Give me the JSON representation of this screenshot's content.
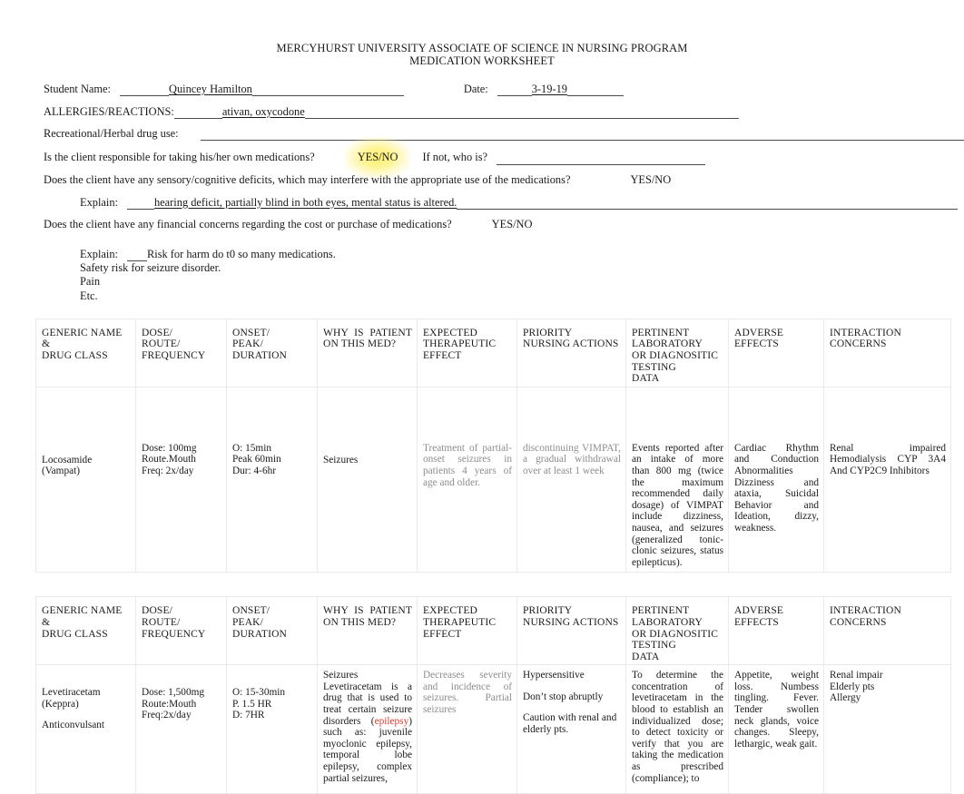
{
  "document": {
    "title_line1": "MERCYHURST UNIVERSITY ASSOCIATE OF SCIENCE IN NURSING PROGRAM",
    "title_line2": "MEDICATION WORKSHEET"
  },
  "form": {
    "student_name_label": "Student Name:",
    "student_name_value": "Quincey Hamilton",
    "date_label": "Date:",
    "date_value": "3-19-19",
    "allergies_label": "ALLERGIES/REACTIONS:",
    "allergies_value": "ativan, oxycodone",
    "recreational_label": "Recreational/Herbal drug use:",
    "recreational_value": "",
    "q1_text": "Is the client responsible for taking his/her own medications?",
    "q1_answer": "YES/NO",
    "q1_followup": "If not, who is?",
    "q1_followup_value": "",
    "q2_text": "Does the client have any sensory/cognitive deficits, which may interfere with the appropriate use of the medications?",
    "q2_answer": "YES/NO",
    "q2_explain_label": "Explain:",
    "q2_explain_value": "hearing deficit, partially blind in both eyes, mental status is altered.",
    "q3_text": "Does the client have any financial concerns regarding the cost or purchase of medications?",
    "q3_answer": "YES/NO",
    "q3_explain_label": "Explain:",
    "q3_explain_lines": [
      "Risk for harm do t0 so many medications.",
      "Safety risk for seizure disorder.",
      "Pain",
      "Etc."
    ]
  },
  "table_headers": {
    "col1": "GENERIC NAME\n&\nDRUG CLASS",
    "col2": "DOSE/\nROUTE/\nFREQUENCY",
    "col3": "ONSET/\nPEAK/\nDURATION",
    "col4": "WHY IS PATIENT ON THIS MED?",
    "col5": "EXPECTED\nTHERAPEUTIC\nEFFECT",
    "col6": "PRIORITY NURSING ACTIONS",
    "col7": "PERTINENT\nLABORATORY\nOR DIAGNOSITIC\nTESTING\nDATA",
    "col8": "ADVERSE\nEFFECTS",
    "col9": "INTERACTION\nCONCERNS"
  },
  "medications": [
    {
      "generic_name": "Locosamide\n(Vampat)",
      "drug_class": "",
      "dose": "Dose: 100mg",
      "route": "Route.Mouth",
      "frequency": "Freq: 2x/day",
      "onset": "O: 15min",
      "peak": "Peak 60min",
      "duration": "Dur: 4-6hr",
      "why_on_med": "Seizures",
      "why_on_med_detail": "",
      "why_link_word": "",
      "why_on_med_tail": "",
      "expected_effect": "Treatment of partial-onset seizures in patients 4 years of age and older.",
      "nursing_actions": "discontinuing VIMPAT, a gradual withdrawal over at least 1 week",
      "nursing_actions_2": "",
      "nursing_actions_3": "",
      "lab_data": "Events reported after an intake of more than 800 mg (twice the maximum recommended daily dosage) of VIMPAT include dizziness, nausea, and seizures (generalized tonic-clonic seizures, status epilepticus).",
      "adverse_effects": "Cardiac Rhythm and Conduction Abnormalities Dizziness and ataxia, Suicidal Behavior and Ideation, dizzy, weakness.",
      "interactions": "Renal impaired Hemodialysis CYP 3A4 And CYP2C9 Inhibitors"
    },
    {
      "generic_name": "Levetiracetam\n(Keppra)",
      "drug_class": "Anticonvulsant",
      "dose": "Dose: 1,500mg",
      "route": "Route:Mouth",
      "frequency": "Freq:2x/day",
      "onset": "O: 15-30min",
      "peak": "P. 1.5 HR",
      "duration": "D: 7HR",
      "why_on_med": "Seizures",
      "why_on_med_detail": "Levetiracetam is a drug that is used to treat certain seizure disorders (",
      "why_link_word": "epilepsy",
      "why_on_med_tail": ") such as: juvenile myoclonic epilepsy, temporal lobe epilepsy, complex partial seizures,",
      "expected_effect": "Decreases severity and incidence of seizures. Partial seizures",
      "nursing_actions": "Hypersensitive",
      "nursing_actions_2": "Don’t stop abruptly",
      "nursing_actions_3": "Caution with renal and elderly pts.",
      "lab_data": "To determine the concentration of levetiracetam in the blood to establish an individualized dose; to detect toxicity or verify that you are taking the medication as prescribed (compliance); to",
      "adverse_effects": "Appetite, weight loss. Numbess tingling. Fever. Tender swollen neck glands, voice changes. Sleepy, lethargic, weak gait.",
      "interactions": "Renal impair\nElderly pts\nAllergy"
    }
  ],
  "colors": {
    "highlight": "#fff06e",
    "link_red": "#e03b2f",
    "gray_text": "#8d8d8d",
    "border": "#e9e9e9"
  }
}
